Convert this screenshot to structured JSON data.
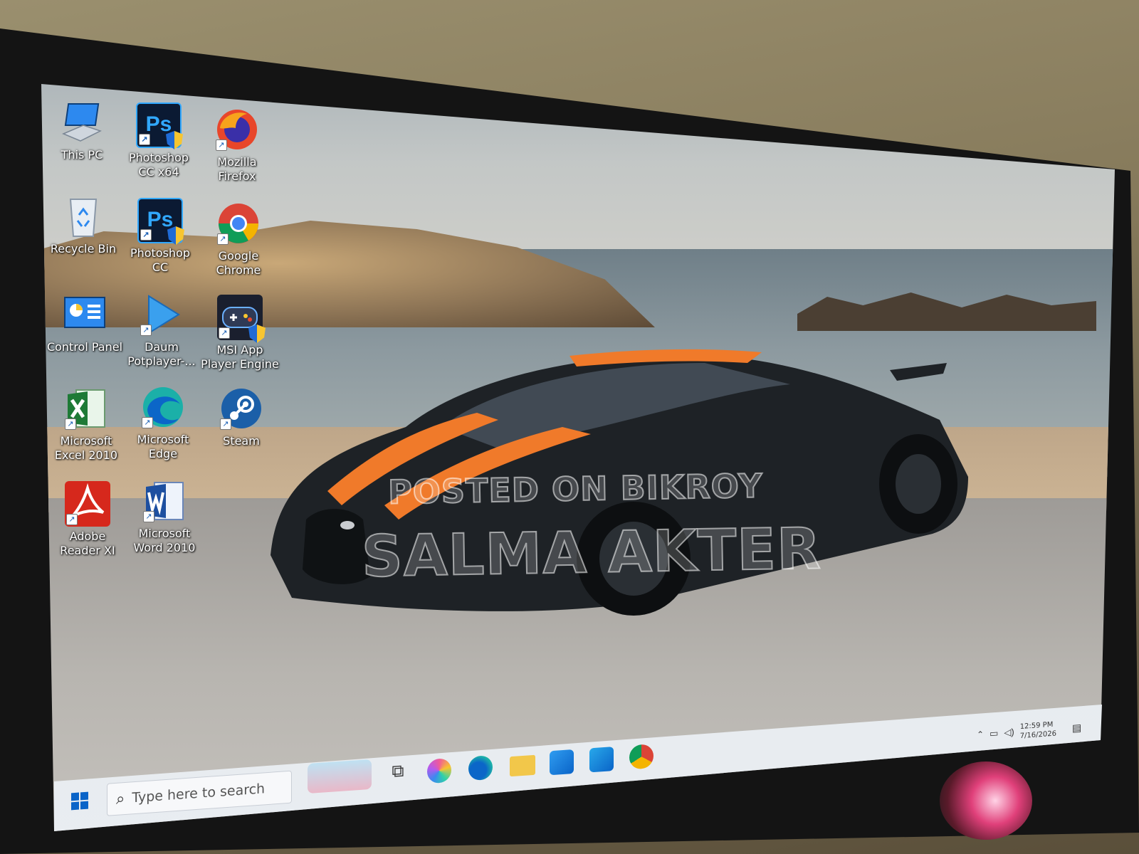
{
  "desktop": {
    "icons": [
      {
        "label": "This PC"
      },
      {
        "label": "Photoshop CC x64"
      },
      {
        "label": "Mozilla Firefox"
      },
      {
        "label": "Recycle Bin"
      },
      {
        "label": "Photoshop CC"
      },
      {
        "label": "Google Chrome"
      },
      {
        "label": "Control Panel"
      },
      {
        "label": "Daum Potplayer-..."
      },
      {
        "label": "MSI App Player Engine"
      },
      {
        "label": "Microsoft Excel 2010"
      },
      {
        "label": "Microsoft Edge"
      },
      {
        "label": "Steam"
      },
      {
        "label": "Adobe Reader XI"
      },
      {
        "label": "Microsoft Word 2010"
      }
    ]
  },
  "watermark": {
    "line1": "POSTED ON BIKROY",
    "line2": "SALMA AKTER"
  },
  "taskbar": {
    "search_placeholder": "Type here to search",
    "pinned": [
      "copilot-icon",
      "edge-icon",
      "file-explorer-icon",
      "store-icon",
      "outlook-icon",
      "chrome-icon"
    ],
    "tray": {
      "time": "12:59 PM",
      "date": "7/16/2026"
    }
  },
  "colors": {
    "accent": "#0a64c8",
    "car_stripe": "#f07a2a",
    "car_body": "#1e2226"
  }
}
